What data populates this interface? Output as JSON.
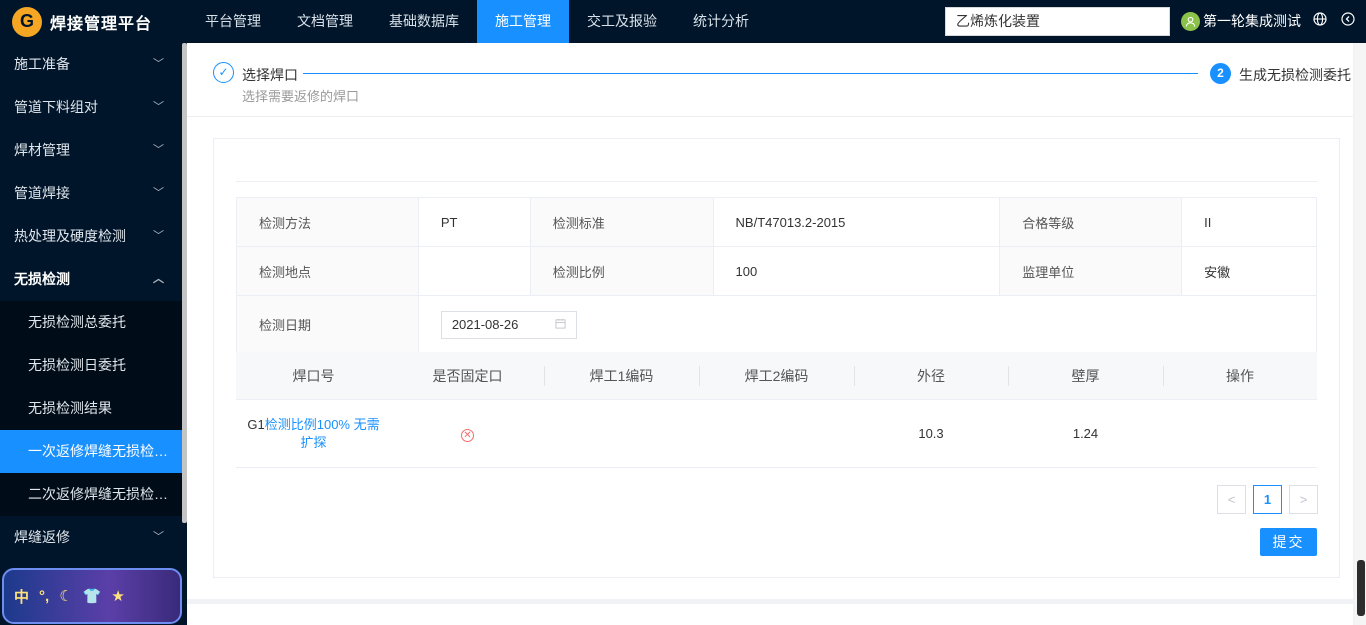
{
  "header": {
    "logo_letter": "G",
    "app_title": "焊接管理平台",
    "nav": [
      {
        "label": "平台管理"
      },
      {
        "label": "文档管理"
      },
      {
        "label": "基础数据库"
      },
      {
        "label": "施工管理"
      },
      {
        "label": "交工及报验"
      },
      {
        "label": "统计分析"
      }
    ],
    "project_select": "乙烯炼化装置",
    "user_name": "第一轮集成测试"
  },
  "sidebar": {
    "items": [
      {
        "label": "施工准备"
      },
      {
        "label": "管道下料组对"
      },
      {
        "label": "焊材管理"
      },
      {
        "label": "管道焊接"
      },
      {
        "label": "热处理及硬度检测"
      },
      {
        "label": "无损检测"
      },
      {
        "label": "焊缝返修"
      }
    ],
    "subitems": [
      {
        "label": "无损检测总委托"
      },
      {
        "label": "无损检测日委托"
      },
      {
        "label": "无损检测结果"
      },
      {
        "label": "一次返修焊缝无损检测委托"
      },
      {
        "label": "二次返修焊缝无损检测委托"
      }
    ],
    "widget_text": "中"
  },
  "steps": {
    "step1_title": "选择焊口",
    "step1_desc": "选择需要返修的焊口",
    "step2_number": "2",
    "step2_title": "生成无损检测委托"
  },
  "form": {
    "method_label": "检测方法",
    "method_value": "PT",
    "standard_label": "检测标准",
    "standard_value": "NB/T47013.2-2015",
    "grade_label": "合格等级",
    "grade_value": "II",
    "location_label": "检测地点",
    "location_value": "",
    "ratio_label": "检测比例",
    "ratio_value": "100",
    "supervisor_label": "监理单位",
    "supervisor_value": "安徽",
    "date_label": "检测日期",
    "date_value": "2021-08-26"
  },
  "table": {
    "headers": [
      "焊口号",
      "是否固定口",
      "焊工1编码",
      "焊工2编码",
      "外径",
      "壁厚",
      "操作"
    ],
    "rows": [
      {
        "weld_no": "G1",
        "weld_note_line1": "检测比例100% 无需",
        "weld_note_line2": "扩探",
        "fixed": "✕",
        "welder1": "",
        "welder2": "",
        "diameter": "10.3",
        "thickness": "1.24",
        "action": ""
      }
    ]
  },
  "pagination": {
    "prev": "<",
    "current": "1",
    "next": ">"
  },
  "submit_label": "提交",
  "colors": {
    "primary": "#1890ff",
    "nav_bg": "#001529",
    "danger": "#f56c6c"
  }
}
